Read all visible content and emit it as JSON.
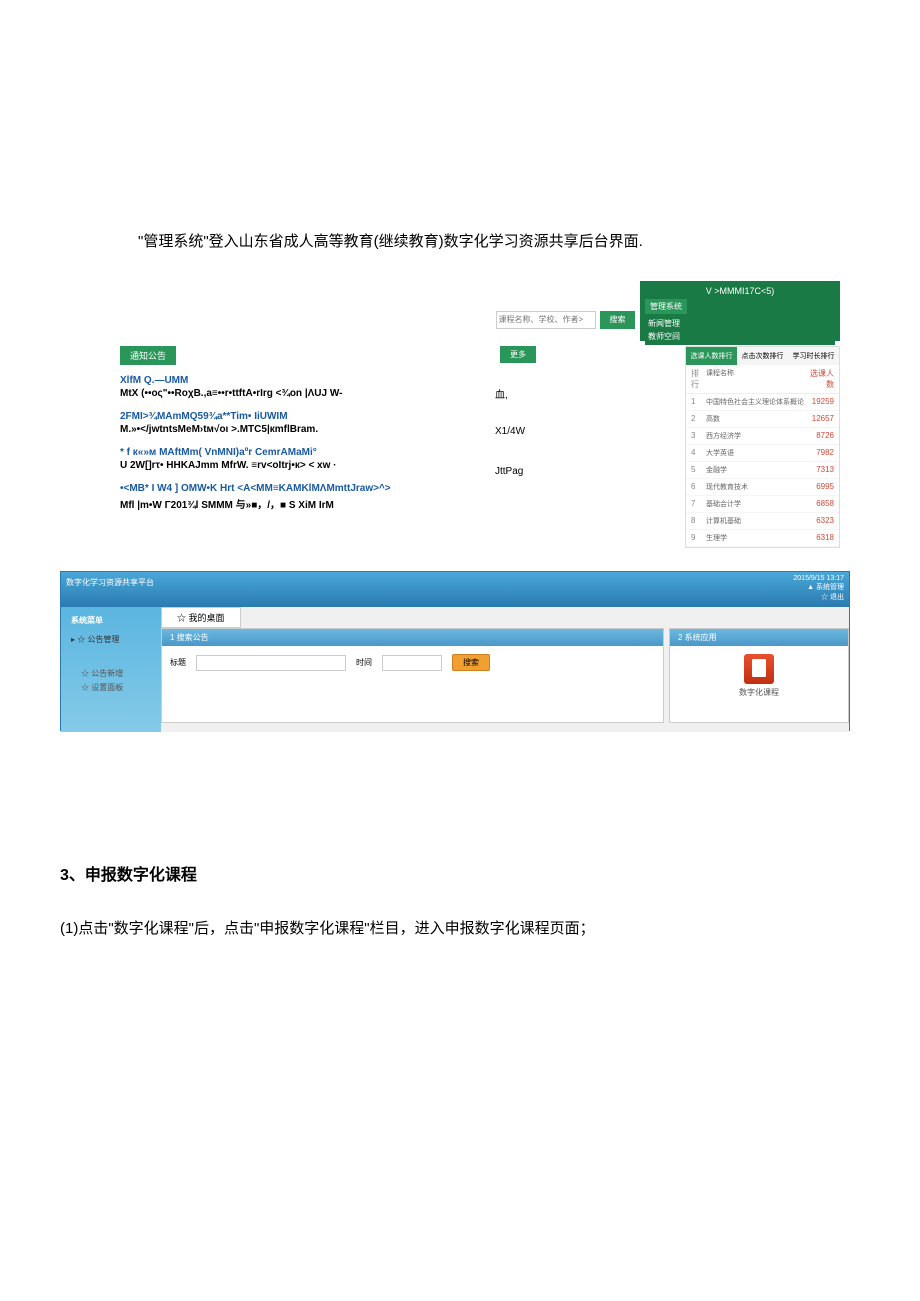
{
  "intro": "\"管理系统\"登入山东省成人高等教育(继续教育)数字化学习资源共享后台界面.",
  "header": {
    "top_text": "V >MMMI17C<5)",
    "sys_label": "管理系统",
    "search_placeholder": "课程名称、学校、作者>",
    "search_btn": "搜索",
    "nav1": "新闻管理",
    "nav2": "教师空间"
  },
  "notice": {
    "header": "通知公告",
    "more": "更多",
    "items": [
      {
        "title": "XlfM          Q.—UMM",
        "desc": "MtX (••oς\"••RoχB.,a≡••r•ttftA•rIrg <¾on |ΛUJ W-",
        "side": "血,"
      },
      {
        "title": "2FMI>¾MAmMQ59¾a**Tim• IiUWIM",
        "desc": "M.»•</jwtntsMeM›tм√οι >.MTC5|кmflBram.",
        "side": "X1/4W"
      },
      {
        "title": "* f к«»м MAftMm( VnMNI)aºr CemrAMaMi°",
        "desc": "U 2W[]rτ• HHKAJmm MfrW. ≡rv<oItrj•к> < xw ·",
        "side": "JttPag"
      },
      {
        "title": "•<MB* I W4 ] OMW•K Hrt <A<MM≡KAMKlMΛMmttJraw>^>",
        "desc": "Mfl |m•W Γ201¾l SMMM 与»■，/，■ S XiM IrM",
        "side": ""
      }
    ]
  },
  "ranking": {
    "tabs": [
      "选课人数排行",
      "点击次数排行",
      "学习时长排行"
    ],
    "col_rank": "排行",
    "col_name": "课程名称",
    "col_count": "选课人数",
    "rows": [
      {
        "num": "1",
        "name": "中国特色社会主义理论体系概论",
        "count": "19259"
      },
      {
        "num": "2",
        "name": "高数",
        "count": "12657"
      },
      {
        "num": "3",
        "name": "西方经济学",
        "count": "8726"
      },
      {
        "num": "4",
        "name": "大学英语",
        "count": "7982"
      },
      {
        "num": "5",
        "name": "金融学",
        "count": "7313"
      },
      {
        "num": "6",
        "name": "现代教育技术",
        "count": "6995"
      },
      {
        "num": "7",
        "name": "基础会计学",
        "count": "6858"
      },
      {
        "num": "8",
        "name": "计算机基础",
        "count": "6323"
      },
      {
        "num": "9",
        "name": "生理学",
        "count": "6318"
      }
    ]
  },
  "admin": {
    "logo_text": "数字化学习资源共享平台",
    "timestamp": "2015/9/15 13:17",
    "user_info": "▲ 系统管理",
    "icons": "☆ 退出",
    "sidebar_header": "系统菜单",
    "sidebar_item1": "▸ ☆ 公告管理",
    "sub_item1": "☆ 公告新增",
    "sub_item2": "☆ 设置面板",
    "tab_label": "☆ 我的桌面",
    "panel1_header": "1 搜索公告",
    "panel2_header": "2 系统应用",
    "form_label1": "标题",
    "form_label2": "时间",
    "search_btn": "搜索",
    "icon_label": "数字化课程"
  },
  "section3": {
    "heading": "3、申报数字化课程",
    "text": "(1)点击\"数字化课程\"后，点击\"申报数字化课程\"栏目，进入申报数字化课程页面；"
  }
}
